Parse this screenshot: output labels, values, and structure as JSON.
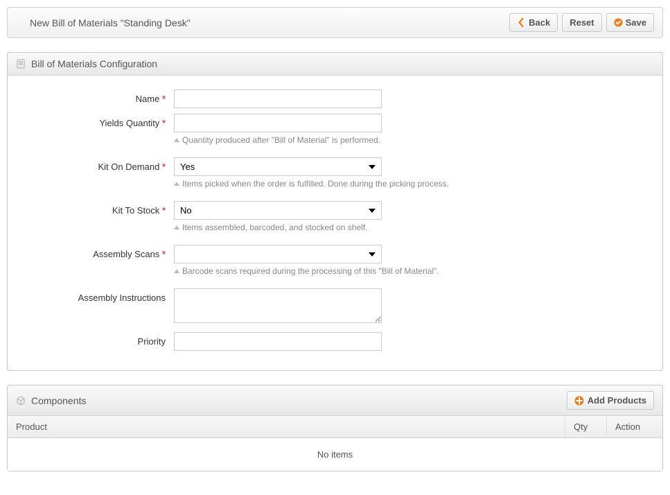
{
  "topBar": {
    "title": "New Bill of Materials \"Standing Desk\"",
    "back": "Back",
    "reset": "Reset",
    "save": "Save"
  },
  "configPanel": {
    "title": "Bill of Materials Configuration",
    "fields": {
      "name": {
        "label": "Name",
        "value": ""
      },
      "yieldsQty": {
        "label": "Yields Quantity",
        "value": "",
        "hint": "Quantity produced after \"Bill of Material\" is performed."
      },
      "kitOnDemand": {
        "label": "Kit On Demand",
        "value": "Yes",
        "hint": "Items picked when the order is fulfilled. Done during the picking process."
      },
      "kitToStock": {
        "label": "Kit To Stock",
        "value": "No",
        "hint": "Items assembled, barcoded, and stocked on shelf."
      },
      "assemblyScans": {
        "label": "Assembly Scans",
        "value": "",
        "hint": "Barcode scans required during the processing of this \"Bill of Material\"."
      },
      "assemblyInstructions": {
        "label": "Assembly Instructions",
        "value": ""
      },
      "priority": {
        "label": "Priority",
        "value": ""
      }
    }
  },
  "componentsPanel": {
    "title": "Components",
    "addButton": "Add Products",
    "columns": {
      "product": "Product",
      "qty": "Qty",
      "action": "Action"
    },
    "noItems": "No items"
  }
}
